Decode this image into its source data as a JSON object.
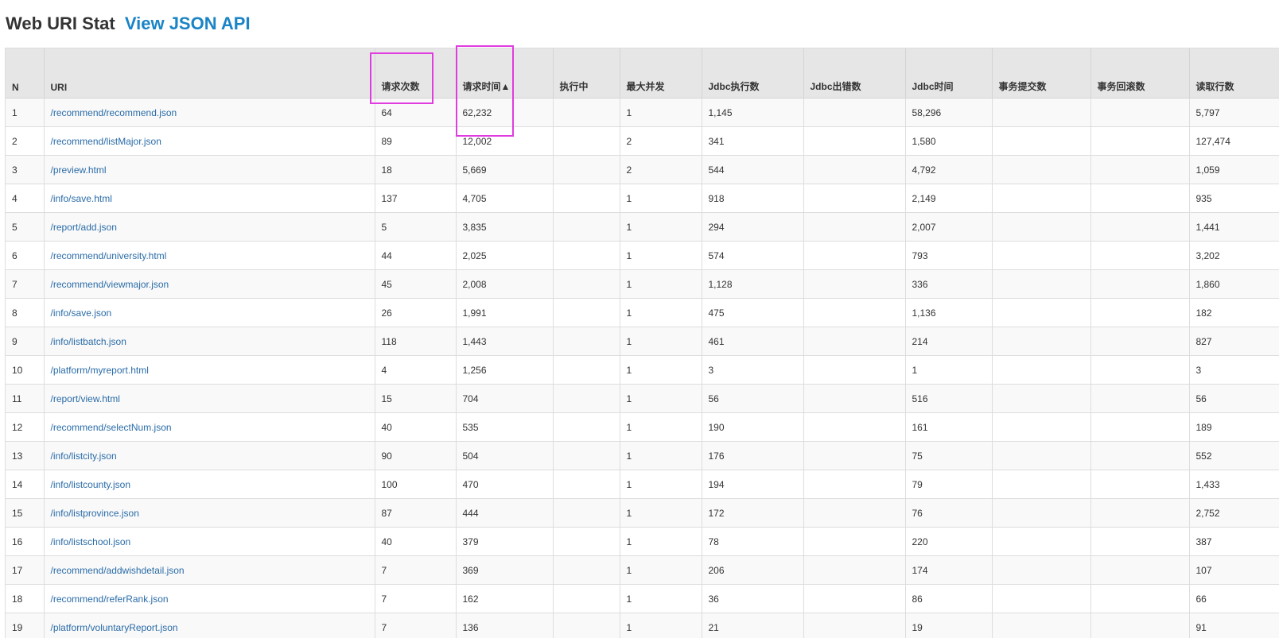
{
  "header": {
    "title": "Web URI Stat",
    "api_link": "View JSON API"
  },
  "table": {
    "columns": [
      "N",
      "URI",
      "请求次数",
      "请求时间▲",
      "执行中",
      "最大并发",
      "Jdbc执行数",
      "Jdbc出错数",
      "Jdbc时间",
      "事务提交数",
      "事务回滚数",
      "读取行数"
    ],
    "rows": [
      [
        "1",
        "/recommend/recommend.json",
        "64",
        "62,232",
        "",
        "1",
        "1,145",
        "",
        "58,296",
        "",
        "",
        "5,797"
      ],
      [
        "2",
        "/recommend/listMajor.json",
        "89",
        "12,002",
        "",
        "2",
        "341",
        "",
        "1,580",
        "",
        "",
        "127,474"
      ],
      [
        "3",
        "/preview.html",
        "18",
        "5,669",
        "",
        "2",
        "544",
        "",
        "4,792",
        "",
        "",
        "1,059"
      ],
      [
        "4",
        "/info/save.html",
        "137",
        "4,705",
        "",
        "1",
        "918",
        "",
        "2,149",
        "",
        "",
        "935"
      ],
      [
        "5",
        "/report/add.json",
        "5",
        "3,835",
        "",
        "1",
        "294",
        "",
        "2,007",
        "",
        "",
        "1,441"
      ],
      [
        "6",
        "/recommend/university.html",
        "44",
        "2,025",
        "",
        "1",
        "574",
        "",
        "793",
        "",
        "",
        "3,202"
      ],
      [
        "7",
        "/recommend/viewmajor.json",
        "45",
        "2,008",
        "",
        "1",
        "1,128",
        "",
        "336",
        "",
        "",
        "1,860"
      ],
      [
        "8",
        "/info/save.json",
        "26",
        "1,991",
        "",
        "1",
        "475",
        "",
        "1,136",
        "",
        "",
        "182"
      ],
      [
        "9",
        "/info/listbatch.json",
        "118",
        "1,443",
        "",
        "1",
        "461",
        "",
        "214",
        "",
        "",
        "827"
      ],
      [
        "10",
        "/platform/myreport.html",
        "4",
        "1,256",
        "",
        "1",
        "3",
        "",
        "1",
        "",
        "",
        "3"
      ],
      [
        "11",
        "/report/view.html",
        "15",
        "704",
        "",
        "1",
        "56",
        "",
        "516",
        "",
        "",
        "56"
      ],
      [
        "12",
        "/recommend/selectNum.json",
        "40",
        "535",
        "",
        "1",
        "190",
        "",
        "161",
        "",
        "",
        "189"
      ],
      [
        "13",
        "/info/listcity.json",
        "90",
        "504",
        "",
        "1",
        "176",
        "",
        "75",
        "",
        "",
        "552"
      ],
      [
        "14",
        "/info/listcounty.json",
        "100",
        "470",
        "",
        "1",
        "194",
        "",
        "79",
        "",
        "",
        "1,433"
      ],
      [
        "15",
        "/info/listprovince.json",
        "87",
        "444",
        "",
        "1",
        "172",
        "",
        "76",
        "",
        "",
        "2,752"
      ],
      [
        "16",
        "/info/listschool.json",
        "40",
        "379",
        "",
        "1",
        "78",
        "",
        "220",
        "",
        "",
        "387"
      ],
      [
        "17",
        "/recommend/addwishdetail.json",
        "7",
        "369",
        "",
        "1",
        "206",
        "",
        "174",
        "",
        "",
        "107"
      ],
      [
        "18",
        "/recommend/referRank.json",
        "7",
        "162",
        "",
        "1",
        "36",
        "",
        "86",
        "",
        "",
        "66"
      ],
      [
        "19",
        "/platform/voluntaryReport.json",
        "7",
        "136",
        "",
        "1",
        "21",
        "",
        "19",
        "",
        "",
        "91"
      ]
    ]
  },
  "colors": {
    "link": "#2a6ca8",
    "title_link": "#1a84c6",
    "header_bg": "#e6e6e6",
    "highlight": "#e03ce0"
  }
}
